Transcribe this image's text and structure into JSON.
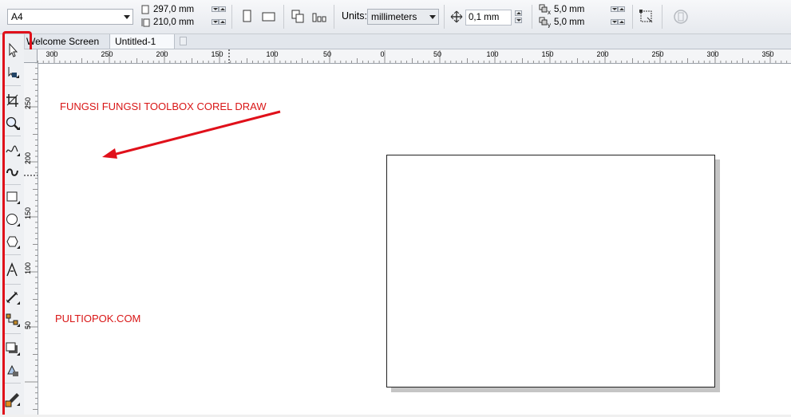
{
  "property_bar": {
    "paper_size": "A4",
    "width": "297,0 mm",
    "height": "210,0 mm",
    "units_label": "Units:",
    "units_value": "millimeters",
    "nudge": "0,1 mm",
    "dup_x": "5,0 mm",
    "dup_y": "5,0 mm"
  },
  "tabs": [
    {
      "label": "Welcome Screen"
    },
    {
      "label": "Untitled-1"
    }
  ],
  "hruler_labels": [
    "300",
    "250",
    "200",
    "150",
    "100",
    "50",
    "0",
    "50",
    "100",
    "150",
    "200",
    "250",
    "300",
    "350"
  ],
  "vruler_labels": [
    "250",
    "200",
    "150",
    "100",
    "50"
  ],
  "annotations": {
    "title": "FUNGSI FUNGSI TOOLBOX COREL DRAW",
    "site": "PULTIOPOK.COM"
  },
  "tools": [
    {
      "name": "pick-tool-icon"
    },
    {
      "name": "shape-tool-icon"
    },
    {
      "name": "crop-tool-icon"
    },
    {
      "name": "zoom-tool-icon"
    },
    {
      "name": "freehand-tool-icon"
    },
    {
      "name": "smart-drawing-tool-icon"
    },
    {
      "name": "rectangle-tool-icon"
    },
    {
      "name": "ellipse-tool-icon"
    },
    {
      "name": "polygon-tool-icon"
    },
    {
      "name": "text-tool-icon"
    },
    {
      "name": "dimension-tool-icon"
    },
    {
      "name": "connector-tool-icon"
    },
    {
      "name": "drop-shadow-tool-icon"
    },
    {
      "name": "transparency-tool-icon"
    },
    {
      "name": "eyedropper-tool-icon"
    }
  ],
  "colors": {
    "annotation_red": "#d91616",
    "highlight_red": "#e0101a"
  }
}
